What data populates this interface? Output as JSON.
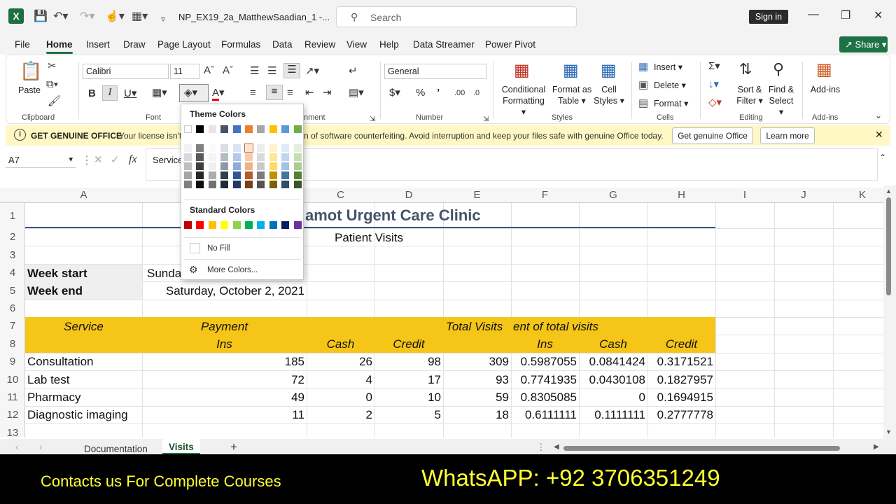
{
  "titlebar": {
    "filename": "NP_EX19_2a_MatthewSaadian_1 -...",
    "search_placeholder": "Search",
    "signin": "Sign in"
  },
  "menu": [
    "File",
    "Home",
    "Insert",
    "Draw",
    "Page Layout",
    "Formulas",
    "Data",
    "Review",
    "View",
    "Help",
    "Data Streamer",
    "Power Pivot"
  ],
  "share": "Share",
  "ribbon": {
    "paste": "Paste",
    "clipboard": "Clipboard",
    "font_name": "Calibri",
    "font_size": "11",
    "font": "Font",
    "alignment": "nment",
    "number_format": "General",
    "number": "Number",
    "cond_fmt": [
      "Conditional",
      "Formatting"
    ],
    "fmt_table": [
      "Format as",
      "Table"
    ],
    "cell_styles": [
      "Cell",
      "Styles"
    ],
    "styles": "Styles",
    "insert": "Insert",
    "delete": "Delete",
    "format": "Format",
    "cells": "Cells",
    "sort": [
      "Sort &",
      "Filter"
    ],
    "find": [
      "Find &",
      "Select"
    ],
    "editing": "Editing",
    "addins": "Add-ins",
    "addins_group": "Add-ins"
  },
  "infobar": {
    "title": "GET GENUINE OFFICE",
    "msg1": "Your license isn't",
    "msg2": "n of software counterfeiting. Avoid interruption and keep your files safe with genuine Office today.",
    "btn1": "Get genuine Office",
    "btn2": "Learn more"
  },
  "formula": {
    "namebox": "A7",
    "value": "Service"
  },
  "columns": [
    "A",
    "C",
    "D",
    "E",
    "F",
    "G",
    "H",
    "I",
    "J",
    "K"
  ],
  "rows": [
    "1",
    "2",
    "3",
    "4",
    "5",
    "6",
    "7",
    "8",
    "9",
    "10",
    "11",
    "12",
    "13"
  ],
  "sheet": {
    "title": "amot Urgent Care Clinic",
    "subtitle": "Patient Visits",
    "week_start_label": "Week start",
    "week_start_val": "Sunda",
    "week_end_label": "Week end",
    "week_end_val": "Saturday, October 2, 2021",
    "h_service": "Service",
    "h_payment": "Payment",
    "h_total": "Total Visits",
    "h_pct": "ent of total visits",
    "h_ins": "Ins",
    "h_cash": "Cash",
    "h_credit": "Credit",
    "h_ins2": "Ins",
    "h_cash2": "Cash",
    "h_credit2": "Credit",
    "data": [
      [
        "Consultation",
        "185",
        "26",
        "98",
        "309",
        "0.5987055",
        "0.0841424",
        "0.3171521"
      ],
      [
        "Lab test",
        "72",
        "4",
        "17",
        "93",
        "0.7741935",
        "0.0430108",
        "0.1827957"
      ],
      [
        "Pharmacy",
        "49",
        "0",
        "10",
        "59",
        "0.8305085",
        "0",
        "0.1694915"
      ],
      [
        "Diagnostic imaging",
        "11",
        "2",
        "5",
        "18",
        "0.6111111",
        "0.1111111",
        "0.2777778"
      ]
    ]
  },
  "tabs": {
    "documentation": "Documentation",
    "visits": "Visits",
    "add": "+"
  },
  "popup": {
    "theme": "Theme Colors",
    "standard": "Standard Colors",
    "nofill": "No Fill",
    "more": "More Colors...",
    "theme_top": [
      "#ffffff",
      "#000000",
      "#e7e6e6",
      "#44546a",
      "#4472c4",
      "#ed7d31",
      "#a5a5a5",
      "#ffc000",
      "#5b9bd5",
      "#70ad47"
    ],
    "standard_colors": [
      "#c00000",
      "#ff0000",
      "#ffc000",
      "#ffff00",
      "#92d050",
      "#00b050",
      "#00b0f0",
      "#0070c0",
      "#002060",
      "#7030a0"
    ]
  },
  "banner": {
    "left": "Contacts us For Complete Courses",
    "right": "WhatsAPP:  +92 3706351249"
  }
}
